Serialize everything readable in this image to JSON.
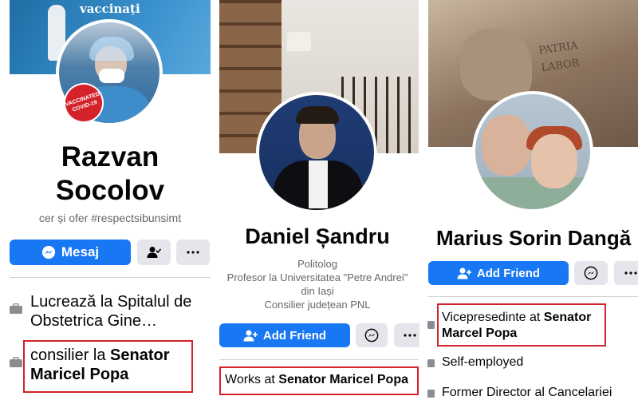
{
  "profile1": {
    "cover_caption": "vaccinați",
    "badge_text": "VACCINATED COVID-19",
    "name_line1": "Razvan",
    "name_line2": "Socolov",
    "bio": "cer și ofer #respectsibunsimt",
    "message_label": "Mesaj",
    "info1": "Lucrează la Spitalul de Obstetrica Gine…",
    "info2_prefix": "consilier la ",
    "info2_bold": "Senator Maricel Popa"
  },
  "profile2": {
    "name": "Daniel Șandru",
    "bio_line1": "Politolog",
    "bio_line2": "Profesor la Universitatea \"Petre Andrei\"",
    "bio_line3": "din Iași",
    "bio_line4": "Consilier județean PNL",
    "add_friend_label": "Add Friend",
    "info_prefix": "Works at ",
    "info_bold": "Senator Maricel Popa"
  },
  "profile3": {
    "cover_text_line1": "PATRIA",
    "cover_text_line2": "LABOR",
    "name": "Marius Sorin Dangă",
    "add_friend_label": "Add Friend",
    "info1_prefix": "Vicepresedinte at ",
    "info1_bold_line1": "Senator",
    "info1_bold_line2": "Marcel Popa",
    "info2": "Self-employed",
    "info3": "Former Director al Cancelariei"
  },
  "colors": {
    "facebook_blue": "#1877f2",
    "highlight_red": "#d3222a",
    "secondary_gray": "#e4e6eb"
  },
  "icons": [
    "messenger-icon",
    "friend-check-icon",
    "more-icon",
    "add-friend-icon",
    "briefcase-icon"
  ]
}
